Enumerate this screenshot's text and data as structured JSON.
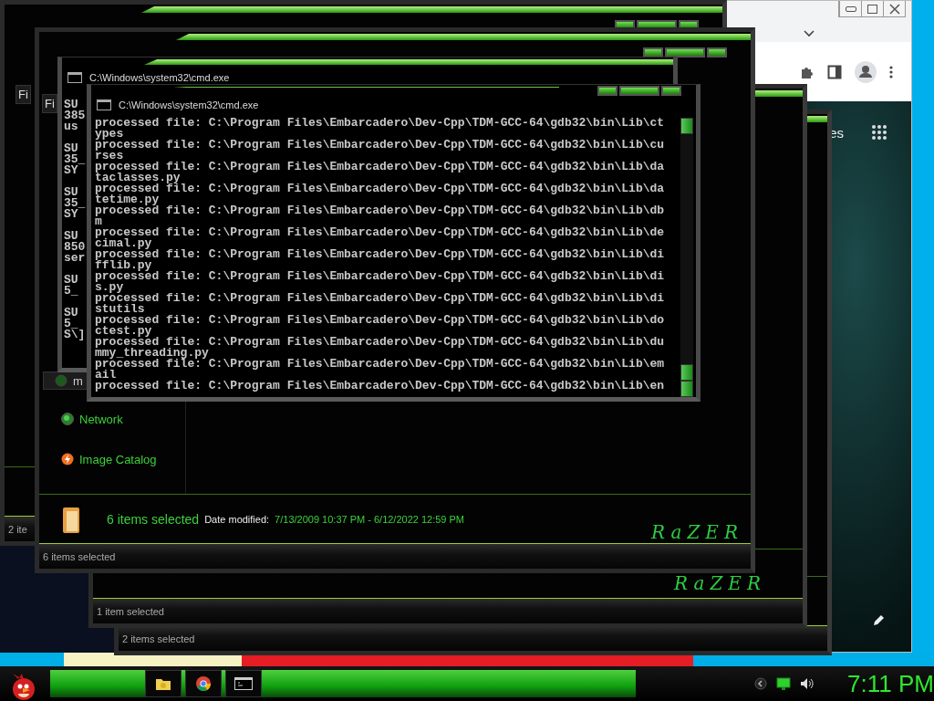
{
  "browser": {
    "partial_text": "es"
  },
  "back_windows": [
    {
      "kind": "plain",
      "status": "2 items selected"
    },
    {
      "kind": "logo",
      "status": "1 item selected",
      "logo": "RaZER"
    },
    {
      "kind": "menu",
      "status": "2 ite",
      "menu_label": "Fi"
    }
  ],
  "explorer": {
    "menu_label": "Fi",
    "nav_items": [
      {
        "kind": "drive",
        "label": "m",
        "selected": true
      },
      {
        "kind": "network",
        "label": "Network",
        "selected": false
      },
      {
        "kind": "catalog",
        "label": "Image Catalog",
        "selected": false
      }
    ],
    "selection_count": "6 items selected",
    "date_label": "Date modified:",
    "date_range": "7/13/2009 10:37 PM - 6/12/2022 12:59 PM",
    "logo": "RaZER",
    "status": "6 items selected"
  },
  "cmd_back": {
    "title": "C:\\Windows\\system32\\cmd.exe",
    "groups": [
      [
        "SU",
        "385",
        "us"
      ],
      [
        "SU",
        "35_",
        "SY"
      ],
      [
        "SU",
        "35_",
        "SY"
      ],
      [
        "SU",
        "850",
        "ser"
      ],
      [
        "SU",
        "5_"
      ],
      [
        "SU",
        "5_",
        "S\\]"
      ]
    ]
  },
  "cmd_front": {
    "title": "C:\\Windows\\system32\\cmd.exe",
    "lines": [
      "processed file: C:\\Program Files\\Embarcadero\\Dev-Cpp\\TDM-GCC-64\\gdb32\\bin\\Lib\\ct",
      "ypes",
      "processed file: C:\\Program Files\\Embarcadero\\Dev-Cpp\\TDM-GCC-64\\gdb32\\bin\\Lib\\cu",
      "rses",
      "processed file: C:\\Program Files\\Embarcadero\\Dev-Cpp\\TDM-GCC-64\\gdb32\\bin\\Lib\\da",
      "taclasses.py",
      "processed file: C:\\Program Files\\Embarcadero\\Dev-Cpp\\TDM-GCC-64\\gdb32\\bin\\Lib\\da",
      "tetime.py",
      "processed file: C:\\Program Files\\Embarcadero\\Dev-Cpp\\TDM-GCC-64\\gdb32\\bin\\Lib\\db",
      "m",
      "processed file: C:\\Program Files\\Embarcadero\\Dev-Cpp\\TDM-GCC-64\\gdb32\\bin\\Lib\\de",
      "cimal.py",
      "processed file: C:\\Program Files\\Embarcadero\\Dev-Cpp\\TDM-GCC-64\\gdb32\\bin\\Lib\\di",
      "fflib.py",
      "processed file: C:\\Program Files\\Embarcadero\\Dev-Cpp\\TDM-GCC-64\\gdb32\\bin\\Lib\\di",
      "s.py",
      "processed file: C:\\Program Files\\Embarcadero\\Dev-Cpp\\TDM-GCC-64\\gdb32\\bin\\Lib\\di",
      "stutils",
      "processed file: C:\\Program Files\\Embarcadero\\Dev-Cpp\\TDM-GCC-64\\gdb32\\bin\\Lib\\do",
      "ctest.py",
      "processed file: C:\\Program Files\\Embarcadero\\Dev-Cpp\\TDM-GCC-64\\gdb32\\bin\\Lib\\du",
      "mmy_threading.py",
      "processed file: C:\\Program Files\\Embarcadero\\Dev-Cpp\\TDM-GCC-64\\gdb32\\bin\\Lib\\em",
      "ail",
      "processed file: C:\\Program Files\\Embarcadero\\Dev-Cpp\\TDM-GCC-64\\gdb32\\bin\\Lib\\en"
    ]
  },
  "taskbar": {
    "buttons": [
      {
        "kind": "folder"
      },
      {
        "kind": "browser"
      },
      {
        "kind": "console"
      }
    ],
    "clock": "7:11 PM"
  }
}
